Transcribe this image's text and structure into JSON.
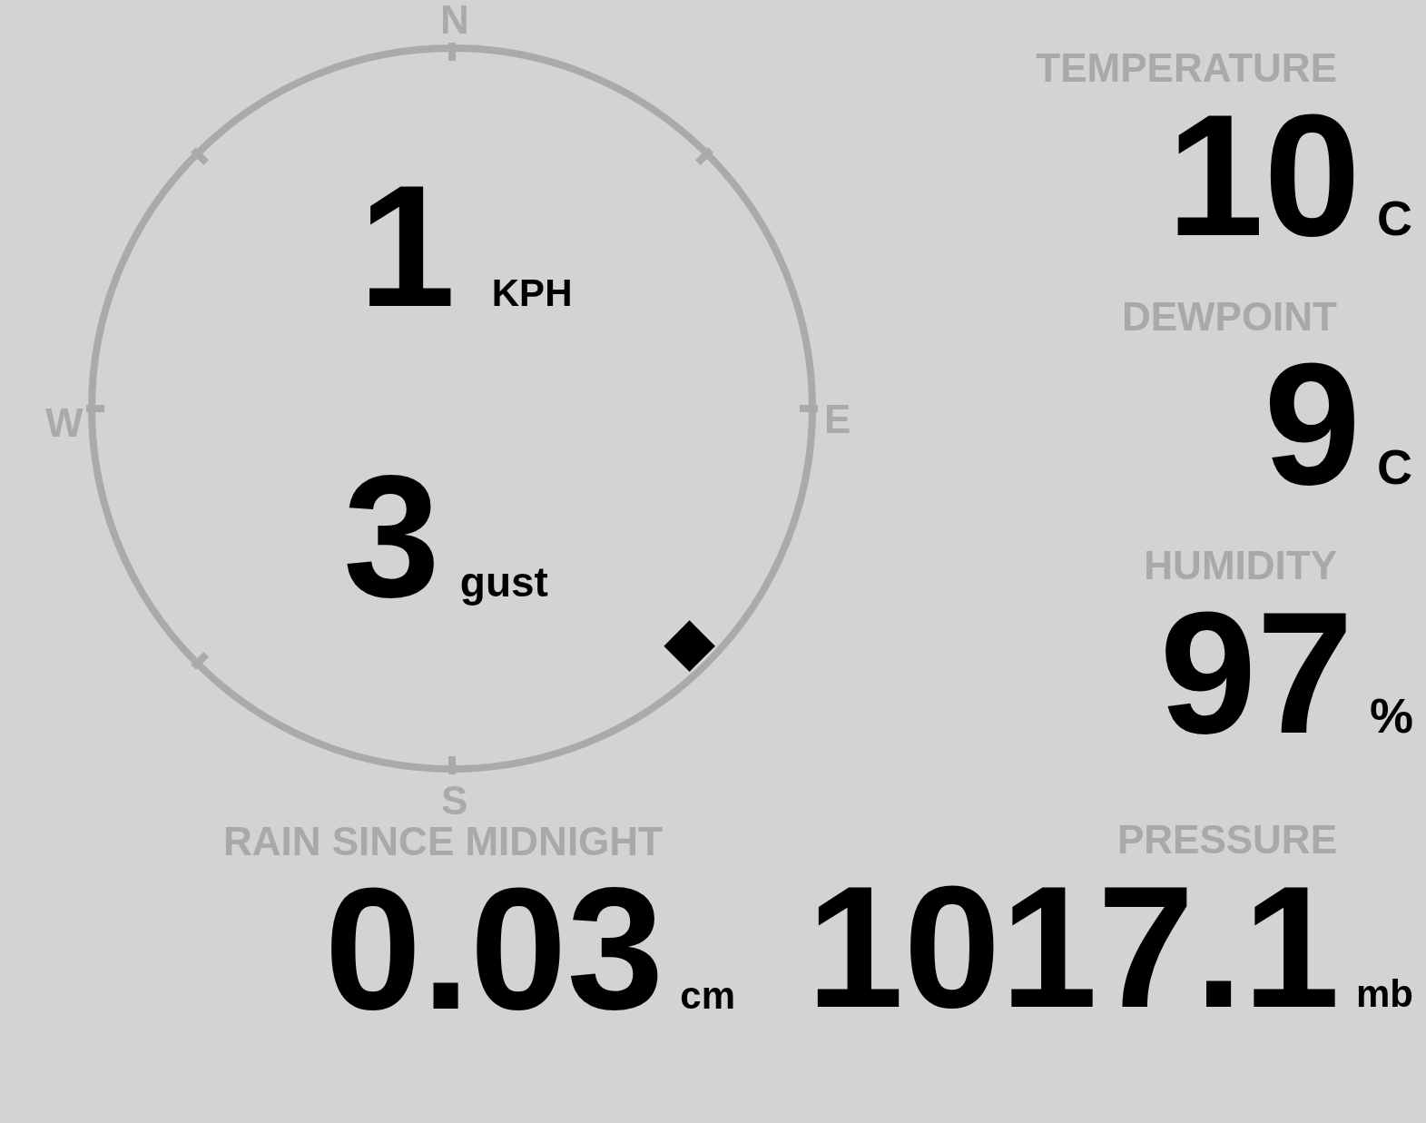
{
  "compass": {
    "north": "N",
    "east": "E",
    "south": "S",
    "west": "W",
    "direction_points": [
      {
        "selected": false
      },
      {
        "selected": false
      },
      {
        "selected": false
      },
      {
        "selected": true
      },
      {
        "selected": false
      },
      {
        "selected": false
      },
      {
        "selected": false
      },
      {
        "selected": false
      }
    ]
  },
  "wind": {
    "speed": "1",
    "speed_unit": "KPH",
    "gust": "3",
    "gust_unit": "gust"
  },
  "readings": [
    {
      "label": "TEMPERATURE",
      "value": "10",
      "unit": "C"
    },
    {
      "label": "DEWPOINT",
      "value": "9",
      "unit": "C"
    },
    {
      "label": "HUMIDITY",
      "value": "97",
      "unit": "%"
    }
  ],
  "rain": {
    "label": "RAIN SINCE MIDNIGHT",
    "value": "0.03",
    "unit": "cm"
  },
  "pressure": {
    "label": "PRESSURE",
    "value": "1017.1",
    "unit": "mb"
  }
}
